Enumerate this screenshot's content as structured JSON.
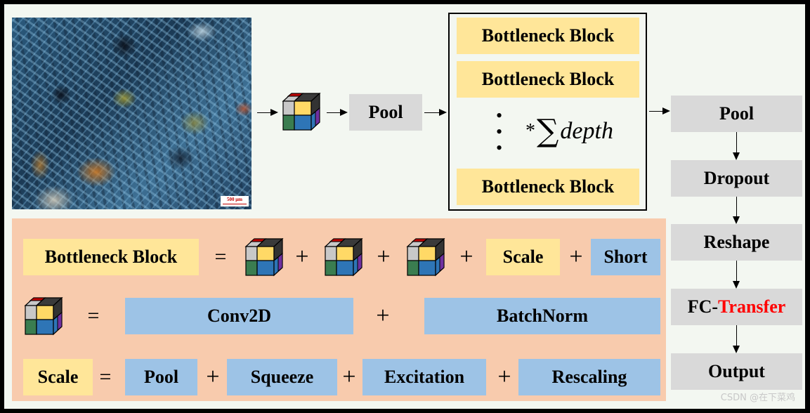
{
  "micrograph": {
    "label": "thin-section micrograph",
    "scale_bar": "500 μm"
  },
  "top_flow": {
    "pool_label": "Pool"
  },
  "stack": {
    "blocks": [
      "Bottleneck Block",
      "Bottleneck Block",
      "Bottleneck Block"
    ],
    "ellipsis": "⋮",
    "multiplier_star": "*",
    "multiplier_sigma": "∑",
    "multiplier_var": "depth"
  },
  "right_column": {
    "pool": "Pool",
    "dropout": "Dropout",
    "reshape": "Reshape",
    "fc_prefix": "FC-",
    "fc_highlight": "Transfer",
    "output": "Output"
  },
  "legend": {
    "row1": {
      "lhs": "Bottleneck Block",
      "eq": "=",
      "plus": "+",
      "scale": "Scale",
      "short": "Short"
    },
    "row2": {
      "eq": "=",
      "conv": "Conv2D",
      "plus": "+",
      "bn": "BatchNorm"
    },
    "row3": {
      "lhs": "Scale",
      "eq": "=",
      "plus": "+",
      "pool": "Pool",
      "squeeze": "Squeeze",
      "excitation": "Excitation",
      "rescaling": "Rescaling"
    }
  },
  "colors": {
    "bottleneck_fill": "#ffe699",
    "gray_fill": "#d9d9d9",
    "blue_fill": "#9dc3e6",
    "panel_fill": "#f8cbad",
    "highlight_text": "#ff0000",
    "cube": {
      "top_left": "#c00000",
      "top_right": "#3a3a3a",
      "front_gray": "#c8c8c8",
      "front_yellow": "#ffd966",
      "front_green": "#3a7d50",
      "front_blue": "#2e75b6",
      "side_dark": "#333333",
      "side_purple": "#7030a0"
    }
  },
  "watermark": "CSDN @在下菜鸡"
}
